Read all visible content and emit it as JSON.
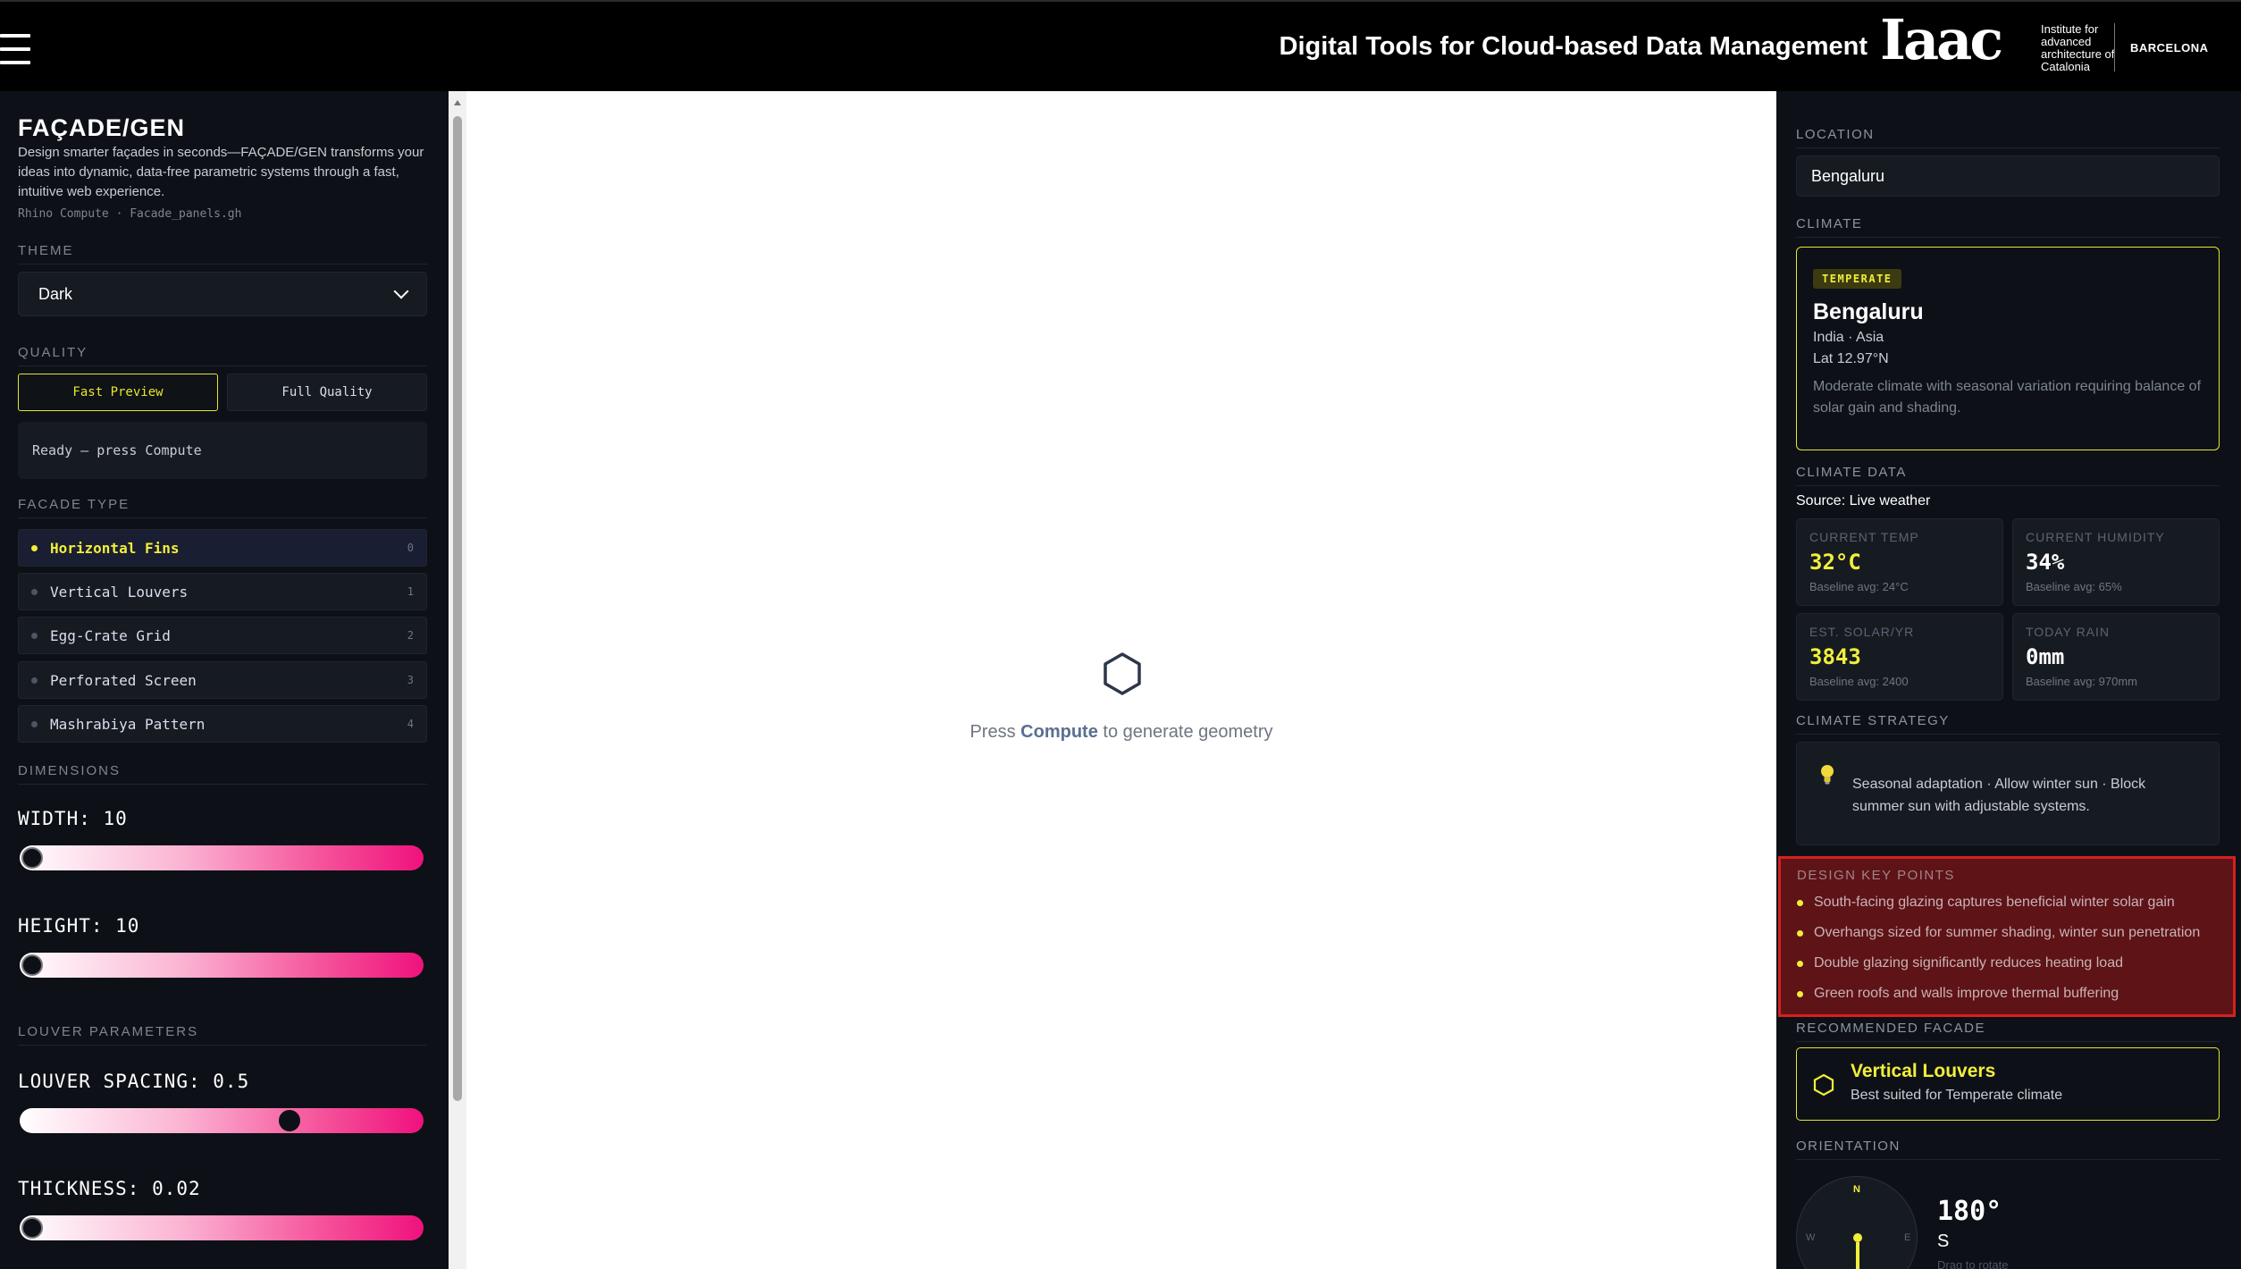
{
  "header": {
    "title": "Digital Tools for Cloud-based Data Management",
    "logo_text": "Iaac",
    "institute": "Institute for advanced architecture of Catalonia",
    "city": "BARCELONA"
  },
  "left": {
    "brand": "FAÇADE/GEN",
    "description": "Design smarter façades in seconds—FAÇADE/GEN transforms your ideas into dynamic, data-free parametric systems through a fast, intuitive web experience.",
    "source": "Rhino Compute · Facade_panels.gh",
    "theme_label": "THEME",
    "theme_value": "Dark",
    "quality_label": "QUALITY",
    "quality_options": [
      "Fast Preview",
      "Full Quality"
    ],
    "status": "Ready — press Compute",
    "facade_type_label": "FACADE TYPE",
    "facade_types": [
      {
        "label": "Horizontal Fins",
        "num": "0"
      },
      {
        "label": "Vertical Louvers",
        "num": "1"
      },
      {
        "label": "Egg-Crate Grid",
        "num": "2"
      },
      {
        "label": "Perforated Screen",
        "num": "3"
      },
      {
        "label": "Mashrabiya Pattern",
        "num": "4"
      }
    ],
    "dimensions_label": "DIMENSIONS",
    "width_label": "WIDTH: 10",
    "height_label": "HEIGHT: 10",
    "louver_label": "LOUVER PARAMETERS",
    "spacing_label": "LOUVER SPACING: 0.5",
    "thickness_label": "THICKNESS: 0.02",
    "slider_fractions": {
      "width": 0.0,
      "height": 0.0,
      "spacing": 0.68,
      "thickness": 0.0
    }
  },
  "viewport": {
    "msg_prefix": "Press ",
    "msg_action": "Compute",
    "msg_suffix": " to generate geometry"
  },
  "right": {
    "location_label": "LOCATION",
    "location_value": "Bengaluru",
    "climate_label": "CLIMATE",
    "climate_badge": "TEMPERATE",
    "climate_city": "Bengaluru",
    "climate_region": "India · Asia",
    "climate_lat": "Lat 12.97°N",
    "climate_desc": "Moderate climate with seasonal variation requiring balance of solar gain and shading.",
    "climate_data_label": "CLIMATE DATA",
    "source_line": "Source: Live weather",
    "stats": [
      {
        "title": "CURRENT TEMP",
        "value": "32°C",
        "baseline": "Baseline avg: 24°C",
        "highlight": true
      },
      {
        "title": "CURRENT HUMIDITY",
        "value": "34%",
        "baseline": "Baseline avg: 65%",
        "highlight": false
      },
      {
        "title": "EST. SOLAR/YR",
        "value": "3843",
        "baseline": "Baseline avg: 2400",
        "highlight": true
      },
      {
        "title": "TODAY RAIN",
        "value": "0mm",
        "baseline": "Baseline avg: 970mm",
        "highlight": false
      }
    ],
    "strategy_label": "CLIMATE STRATEGY",
    "strategy_text": "Seasonal adaptation · Allow winter sun · Block summer sun with adjustable systems.",
    "keypoints_label": "DESIGN KEY POINTS",
    "keypoints": [
      "South-facing glazing captures beneficial winter solar gain",
      "Overhangs sized for summer shading, winter sun penetration",
      "Double glazing significantly reduces heating load",
      "Green roofs and walls improve thermal buffering"
    ],
    "recommended_label": "RECOMMENDED FACADE",
    "recommended_title": "Vertical Louvers",
    "recommended_sub": "Best suited for Temperate climate",
    "orientation_label": "ORIENTATION",
    "compass": {
      "n": "N",
      "w": "W",
      "e": "E"
    },
    "orientation_deg": "180°",
    "orientation_dir": "S",
    "orientation_hint": "Drag to rotate"
  },
  "colors": {
    "accent": "#f2ee3a",
    "slider_end": "#f0117d",
    "highlight_border": "#d62020"
  }
}
